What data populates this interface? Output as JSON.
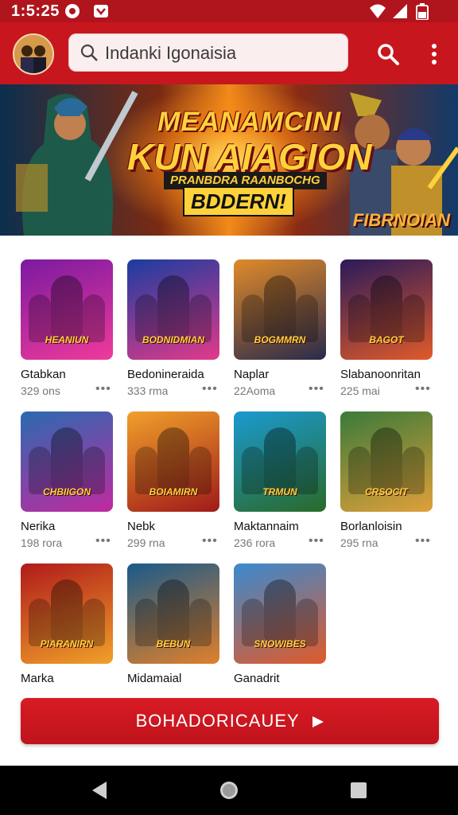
{
  "status_bar": {
    "time": "1:5:25",
    "icons": [
      "notification-circle-icon",
      "notification-app-icon",
      "wifi-icon",
      "signal-icon",
      "battery-icon"
    ]
  },
  "app_bar": {
    "search": {
      "value": "Indanki Igonaisia",
      "icon": "search-icon"
    },
    "actions": [
      "search-icon",
      "more-vert-icon"
    ]
  },
  "hero": {
    "title_line1": "MEANAMCINI",
    "title_line2": "KUN AIAGION",
    "strip1": "PRANBDRA RAANBOCHG",
    "strip2": "BDDERN!",
    "corner": "FIBRNOIAN"
  },
  "games": [
    {
      "name": "Gtabkan",
      "size": "329 ons",
      "thumb_label": "HEANIUN",
      "colors": [
        "#7a1aa0",
        "#f03a9c"
      ]
    },
    {
      "name": "Bedonineraida",
      "size": "333 rma",
      "thumb_label": "BODNIDMIAN",
      "colors": [
        "#1a3ca0",
        "#e23a8a"
      ]
    },
    {
      "name": "Naplar",
      "size": "22Aoma",
      "thumb_label": "BOGMMRN",
      "colors": [
        "#e08a2a",
        "#2a2a4a"
      ]
    },
    {
      "name": "Slabanoonritan",
      "size": "225 mai",
      "thumb_label": "BAGOT",
      "colors": [
        "#2a1a5a",
        "#e05a2a"
      ]
    },
    {
      "name": "Nerika",
      "size": "198 rora",
      "thumb_label": "CHBIIGON",
      "colors": [
        "#2a6ab0",
        "#c02aa0"
      ]
    },
    {
      "name": "Nebk",
      "size": "299 rna",
      "thumb_label": "BOIAMIRN",
      "colors": [
        "#f0a02a",
        "#a01a1a"
      ]
    },
    {
      "name": "Maktannaim",
      "size": "236 rora",
      "thumb_label": "TRMUN",
      "colors": [
        "#1a9ad0",
        "#2a6a2a"
      ]
    },
    {
      "name": "Borlanloisin",
      "size": "295 rna",
      "thumb_label": "CRSOCIT",
      "colors": [
        "#3a7a3a",
        "#e0a03a"
      ]
    },
    {
      "name": "Marka",
      "size": "",
      "thumb_label": "PIARANIRN",
      "colors": [
        "#b01a1a",
        "#f0a02a"
      ]
    },
    {
      "name": "Midamaial",
      "size": "",
      "thumb_label": "BEBUN",
      "colors": [
        "#1a5a8a",
        "#e0802a"
      ]
    },
    {
      "name": "Ganadrit",
      "size": "",
      "thumb_label": "SNOWIBES",
      "colors": [
        "#3a8ad0",
        "#e05a2a"
      ]
    }
  ],
  "cta": {
    "label": "BOHADORICAUEY",
    "icon": "arrow-right-icon"
  },
  "nav_bar": {
    "buttons": [
      "back-icon",
      "home-icon",
      "recents-icon"
    ]
  }
}
